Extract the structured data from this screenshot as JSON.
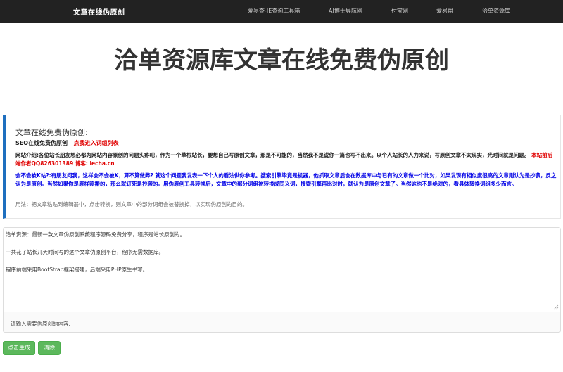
{
  "navbar": {
    "brand": "文章在线伪原创",
    "items": [
      {
        "label": "爱易查-IE查询工具箱"
      },
      {
        "label": "AI博士导航网"
      },
      {
        "label": "付宝网"
      },
      {
        "label": "爱易盘"
      },
      {
        "label": "洽单资源库"
      }
    ]
  },
  "hero": {
    "title": "洽单资源库文章在线免费伪原创"
  },
  "info": {
    "title": "文章在线免费伪原创:",
    "seo_label": "SEO在线免费伪原创",
    "seo_link": "点我进入词组列表",
    "intro": "网站介绍:各位站长朋友想必都为网站内容原创的问题头疼吧，作为一个草根站长，要想自己写原创文章，那是不可能的，当然我不是说你一篇也写不出来。以个人站长的人力来说，写原创文章不太现实，光时间就是问题。",
    "intro_red": "本站前后端作者QQ826301389 博客: lecha.cn",
    "faq": "会不会被K站?:有朋友问我，这样会不会被K，算不算做弊?        就这个问题我发表一下个人的看法供你参考。搜索引擎毕竟是机器，他抓取文章后会在数据库中与已有的文章做一个比对，如果发现有相似度很高的文章则认为是抄袭，反之认为是原创。当然如果你是原样照搬的，那么就订死是抄袭的。用伪原创工具转换后，文章中的部分词组被转换成同义词，搜索引擎再比对时，就认为是原创文章了。当然这也不是绝对的，看具体转换词组多少而言。",
    "usage": "用法：把文章粘贴到编辑器中，点击转换，则文章中的部分词组会被替换掉，以实现伪原创的目的。"
  },
  "editor": {
    "paragraphs": [
      "洽单资源：最新一款文章伪原创系统程序源码免费分享，程序是站长原创的。",
      "一共花了站长几天时间写的这个文章伪原创平台，程序无需数据库。",
      "程序前端采用BootStrap框架搭建，后端采用PHP原生书写。"
    ],
    "hint": "请输入需要伪原创的内容:"
  },
  "buttons": {
    "generate": "点击生成",
    "clear": "清除"
  },
  "colors": {
    "navbar_bg": "#222222",
    "accent_blue": "#1e6fbf",
    "link_red": "#e00000",
    "faq_blue": "#0000e6",
    "button_green": "#5cb85c"
  }
}
